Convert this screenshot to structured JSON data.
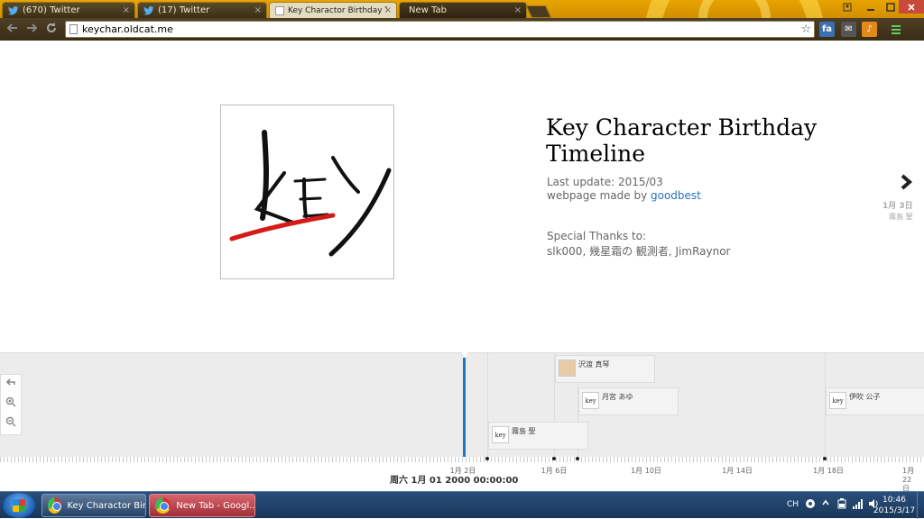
{
  "browser": {
    "tabs": [
      {
        "label": "(670) Twitter",
        "icon": "twitter-icon"
      },
      {
        "label": "(17) Twitter",
        "icon": "twitter-icon"
      },
      {
        "label": "Key Charactor Birthday Ti",
        "icon": "page-icon"
      },
      {
        "label": "New Tab",
        "icon": ""
      }
    ],
    "close_glyph": "×",
    "url": "keychar.oldcat.me",
    "extensions": [
      {
        "label": "fa",
        "color": "#3a6fb0"
      },
      {
        "label": "✉",
        "color": "#555555"
      },
      {
        "label": "♪",
        "color": "#e08a1a"
      },
      {
        "label": "▪",
        "color": "#3aa040"
      }
    ]
  },
  "page": {
    "logo_text": "KEY",
    "title": "Key Character Birthday Timeline",
    "last_update": "Last update: 2015/03",
    "made_by_prefix": "webpage made by ",
    "made_by_link": "goodbest",
    "thanks_title": "Special Thanks to:",
    "thanks_names": "slk000, 幾星霜の 観測者, JimRaynor",
    "next_slide": {
      "date": "1月 3日",
      "name": "霧島 聖"
    }
  },
  "timeline": {
    "events": [
      {
        "name": "沢渡 真琴",
        "thumb": "key"
      },
      {
        "name": "月宮 あゆ",
        "thumb": "key"
      },
      {
        "name": "伊吹 公子",
        "thumb": "key"
      },
      {
        "name": "霧島 聖",
        "thumb": "key"
      }
    ],
    "ticks": [
      "1月 2日",
      "1月 6日",
      "1月 10日",
      "1月 14日",
      "1月 18日",
      "1月 22日"
    ],
    "current_date": "周六 1月 01 2000 00:00:00"
  },
  "taskbar": {
    "tasks": [
      "Key Charactor Birt...",
      "New Tab - Googl..."
    ],
    "lang": "CH",
    "time": "10:46",
    "date": "2015/3/17"
  },
  "colors": {
    "accent": "#1d78c4",
    "link": "#2a72b8"
  }
}
